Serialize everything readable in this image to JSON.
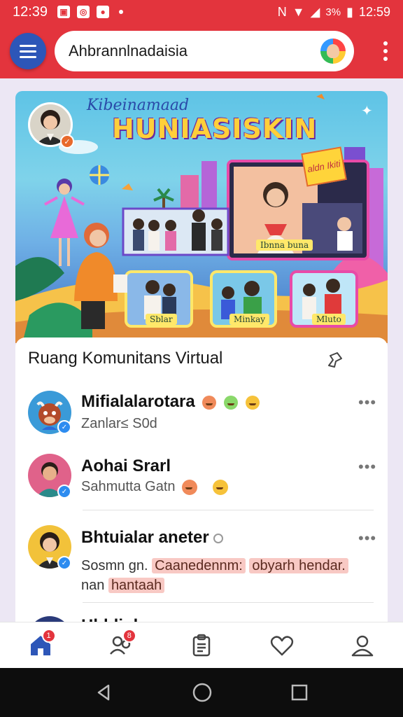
{
  "status_bar": {
    "time": "12:39",
    "battery_text": "3%",
    "clock_right": "12:59"
  },
  "app_bar": {
    "search_value": "Ahbrannlnadaisia"
  },
  "banner": {
    "subtitle": "Kibeinamaad",
    "title": "HUNIASISKIN",
    "sign_text": "aldn Ikiti",
    "screen_label": "Ibnna buna",
    "thumb_labels": [
      "Sblar",
      "Minkay",
      "Mluto"
    ]
  },
  "card": {
    "title": "Ruang Komunitans Virtual",
    "items": [
      {
        "name": "Mifialalarotara",
        "sub": "Zanlar≤ S0d"
      },
      {
        "name": "Aohai Srarl",
        "sub": "Sahmutta Gatn"
      },
      {
        "name": "Bhtuialar aneter",
        "msg_plain_1": "Sosmn gn.",
        "msg_hl_1": "Caanedennm:",
        "msg_hl_2": "obyarh hendar.",
        "msg_plain_2": "nan",
        "msg_hl_3": "hantaah"
      },
      {
        "name": "Hbldigh"
      }
    ]
  },
  "bottom_nav": {
    "home_badge": "1",
    "people_badge": "8"
  },
  "colors": {
    "accent": "#e3343d",
    "menu": "#2d56b8",
    "nav_active": "#2d56b8"
  }
}
